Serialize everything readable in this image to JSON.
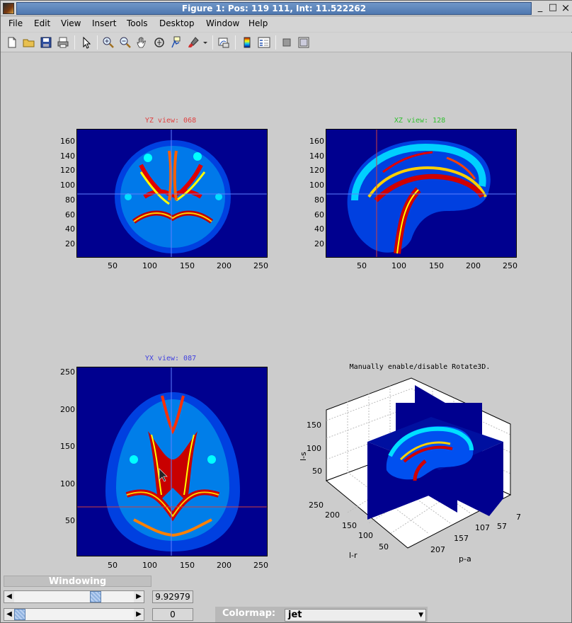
{
  "window": {
    "title": "Figure 1: Pos: 119 111, Int: 11.522262",
    "minimize_glyph": "_",
    "maximize_glyph": "□",
    "close_glyph": "×"
  },
  "menubar": {
    "items": [
      {
        "label": "File",
        "key": "F"
      },
      {
        "label": "Edit",
        "key": "E"
      },
      {
        "label": "View",
        "key": "V"
      },
      {
        "label": "Insert",
        "key": "I"
      },
      {
        "label": "Tools",
        "key": "T"
      },
      {
        "label": "Desktop",
        "key": "D"
      },
      {
        "label": "Window",
        "key": "W"
      },
      {
        "label": "Help",
        "key": "H"
      }
    ]
  },
  "toolbar": {
    "icons": [
      "new-file-icon",
      "open-folder-icon",
      "save-icon",
      "print-icon",
      "pointer-icon",
      "zoom-in-icon",
      "zoom-out-icon",
      "pan-hand-icon",
      "rotate-3d-icon",
      "data-cursor-icon",
      "brush-icon",
      "link-plot-icon",
      "colorbar-icon",
      "legend-icon",
      "hide-plot-tools-icon",
      "show-plot-tools-icon"
    ]
  },
  "axes": {
    "yz": {
      "title": "YZ view: 068",
      "title_color": "#e04040",
      "x_ticks": [
        "50",
        "100",
        "150",
        "200",
        "250"
      ],
      "y_ticks": [
        "160",
        "140",
        "120",
        "100",
        "80",
        "60",
        "40",
        "20"
      ]
    },
    "xz": {
      "title": "XZ view: 128",
      "title_color": "#30c030",
      "x_ticks": [
        "50",
        "100",
        "150",
        "200",
        "250"
      ],
      "y_ticks": [
        "160",
        "140",
        "120",
        "100",
        "80",
        "60",
        "40",
        "20"
      ]
    },
    "yx": {
      "title": "YX view: 087",
      "title_color": "#4040e0",
      "x_ticks": [
        "50",
        "100",
        "150",
        "200",
        "250"
      ],
      "y_ticks": [
        "250",
        "200",
        "150",
        "100",
        "50"
      ]
    },
    "view3d": {
      "title": "Manually enable/disable Rotate3D.",
      "z_label": "l-s",
      "z_ticks": [
        "150",
        "100",
        "50"
      ],
      "lr_label": "l-r",
      "lr_ticks": [
        "250",
        "200",
        "150",
        "100",
        "50"
      ],
      "pa_label": "p-a",
      "pa_ticks": [
        "207",
        "157",
        "107",
        "57",
        "7"
      ]
    }
  },
  "controls": {
    "windowing_label": "Windowing",
    "window_value": "9.92979",
    "level_value": "0",
    "window_slider_fraction": 0.7,
    "level_slider_fraction": 0.0,
    "colormap_label": "Colormap:",
    "colormap_value": "jet"
  },
  "colors": {
    "plot_background": "#00008f",
    "crosshair_red": "#d04040",
    "crosshair_blue": "#4060e0",
    "crosshair_green": "#40c040"
  }
}
